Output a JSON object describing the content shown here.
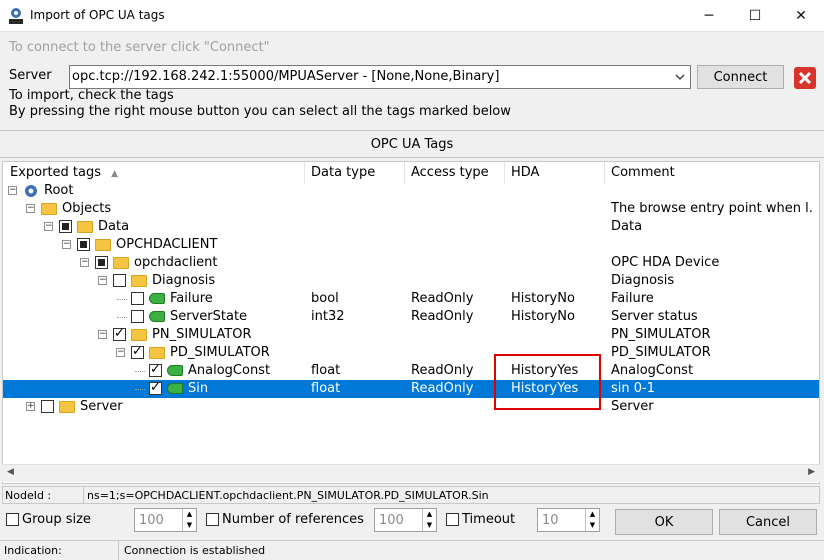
{
  "window": {
    "title": "Import of OPC UA tags",
    "minimize": "─",
    "maximize": "☐",
    "close": "✕"
  },
  "hint": "To connect to the server click \"Connect\"",
  "server": {
    "label": "Server",
    "value": "opc.tcp://192.168.242.1:55000/MPUAServer - [None,None,Binary]",
    "connect_label": "Connect"
  },
  "info": {
    "line1": "To import, check the tags",
    "line2": "By pressing the right mouse button you can select all the tags marked below"
  },
  "section_title": "OPC UA Tags",
  "columns": [
    "Exported tags",
    "Data type",
    "Access type",
    "HDA",
    "Comment"
  ],
  "tree": [
    {
      "name": "Root",
      "data_type": "",
      "access": "",
      "hda": "",
      "comment": "",
      "icon": "root-icon",
      "expander": "minus",
      "check": "none"
    },
    {
      "name": "Objects",
      "data_type": "",
      "access": "",
      "hda": "",
      "comment": "The browse entry point when l.",
      "icon": "folder-icon",
      "expander": "minus",
      "check": "none"
    },
    {
      "name": "Data",
      "data_type": "",
      "access": "",
      "hda": "",
      "comment": "Data",
      "icon": "folder-icon",
      "expander": "minus",
      "check": "partial"
    },
    {
      "name": "OPCHDACLIENT",
      "data_type": "",
      "access": "",
      "hda": "",
      "comment": "",
      "icon": "folder-icon",
      "expander": "minus",
      "check": "partial"
    },
    {
      "name": "opchdaclient",
      "data_type": "",
      "access": "",
      "hda": "",
      "comment": "OPC HDA Device",
      "icon": "folder-icon",
      "expander": "minus",
      "check": "partial"
    },
    {
      "name": "Diagnosis",
      "data_type": "",
      "access": "",
      "hda": "",
      "comment": "Diagnosis",
      "icon": "folder-icon",
      "expander": "minus",
      "check": "unchecked"
    },
    {
      "name": "Failure",
      "data_type": "bool",
      "access": "ReadOnly",
      "hda": "HistoryNo",
      "comment": "Failure",
      "icon": "tag-icon",
      "expander": "none",
      "check": "unchecked"
    },
    {
      "name": "ServerState",
      "data_type": "int32",
      "access": "ReadOnly",
      "hda": "HistoryNo",
      "comment": "Server status",
      "icon": "tag-icon",
      "expander": "none",
      "check": "unchecked"
    },
    {
      "name": "PN_SIMULATOR",
      "data_type": "",
      "access": "",
      "hda": "",
      "comment": "PN_SIMULATOR",
      "icon": "folder-icon",
      "expander": "minus",
      "check": "checked"
    },
    {
      "name": "PD_SIMULATOR",
      "data_type": "",
      "access": "",
      "hda": "",
      "comment": "PD_SIMULATOR",
      "icon": "folder-icon",
      "expander": "minus",
      "check": "checked"
    },
    {
      "name": "AnalogConst",
      "data_type": "float",
      "access": "ReadOnly",
      "hda": "HistoryYes",
      "comment": "AnalogConst",
      "icon": "tag-icon",
      "expander": "none",
      "check": "checked"
    },
    {
      "name": "Sin",
      "data_type": "float",
      "access": "ReadOnly",
      "hda": "HistoryYes",
      "comment": "sin 0-1",
      "icon": "tag-icon",
      "expander": "none",
      "check": "checked",
      "selected": true
    },
    {
      "name": "Server",
      "data_type": "",
      "access": "",
      "hda": "",
      "comment": "Server",
      "icon": "folder-icon",
      "expander": "plus",
      "check": "unchecked"
    }
  ],
  "nodeid": {
    "label": "NodeId :",
    "value": "ns=1;s=OPCHDACLIENT.opchdaclient.PN_SIMULATOR.PD_SIMULATOR.Sin"
  },
  "options": {
    "group_size": {
      "label": "Group size",
      "value": "100"
    },
    "num_refs": {
      "label": "Number of references",
      "value": "100"
    },
    "timeout": {
      "label": "Timeout",
      "value": "10"
    }
  },
  "buttons": {
    "ok": "OK",
    "cancel": "Cancel"
  },
  "status": {
    "label": "Indication:",
    "value": "Connection is established"
  },
  "colors": {
    "selection": "#0078d7",
    "highlight_box": "#e00000",
    "close_red": "#d9342b"
  }
}
